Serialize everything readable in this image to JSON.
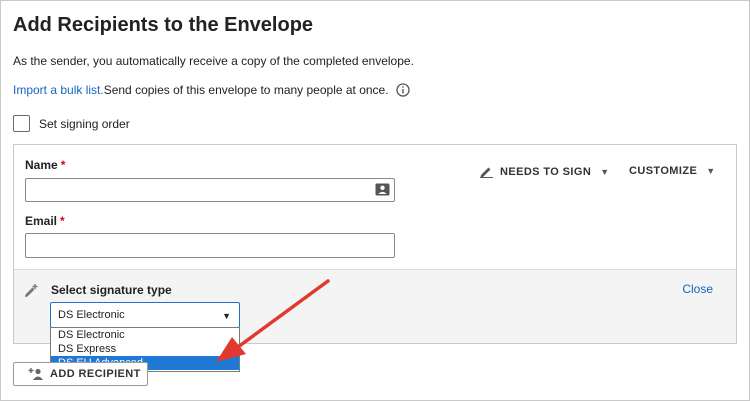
{
  "page": {
    "title": "Add Recipients to the Envelope",
    "subtitle": "As the sender, you automatically receive a copy of the completed envelope.",
    "bulk_link": "Import a bulk list.",
    "bulk_text": " Send copies of this envelope to many people at once.",
    "signing_order_label": "Set signing order"
  },
  "recipient": {
    "name_label": "Name",
    "email_label": "Email",
    "required_mark": "*",
    "name_value": "",
    "email_value": "",
    "role_button": "NEEDS TO SIGN",
    "customize_button": "CUSTOMIZE"
  },
  "signature": {
    "label": "Select signature type",
    "close_label": "Close",
    "selected": "DS Electronic",
    "options": [
      "DS Electronic",
      "DS Express",
      "DS EU Advanced"
    ],
    "highlighted_index": 2
  },
  "actions": {
    "add_recipient": "ADD RECIPIENT"
  },
  "colors": {
    "link": "#1565c0",
    "required": "#d0021b",
    "highlight": "#1e78d4",
    "annotation_arrow": "#e03a2f"
  }
}
